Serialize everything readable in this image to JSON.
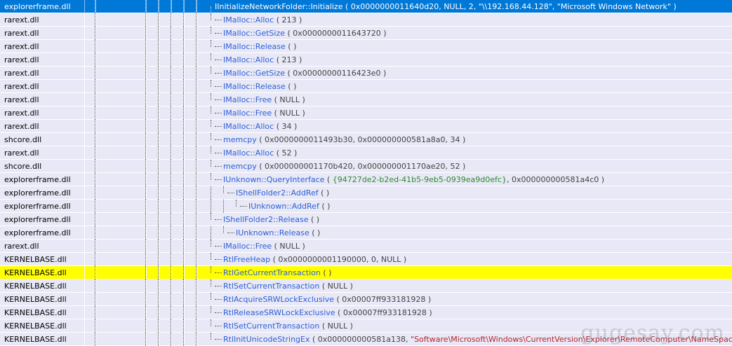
{
  "trace": {
    "rows": [
      {
        "module": "explorerframe.dll",
        "depth": 0,
        "state": "selected",
        "iface": "IInitializeNetworkFolder",
        "fn": "Initialize",
        "args": [
          {
            "t": "plain",
            "v": "( 0x0000000011640d20, NULL, 2, "
          },
          {
            "t": "str",
            "v": "\"\\\\192.168.44.128\""
          },
          {
            "t": "plain",
            "v": ", "
          },
          {
            "t": "str",
            "v": "\"Microsoft Windows Network\""
          },
          {
            "t": "plain",
            "v": " )"
          }
        ]
      },
      {
        "module": "rarext.dll",
        "depth": 1,
        "iface": "IMalloc",
        "fn": "Alloc",
        "args": [
          {
            "t": "plain",
            "v": "( 213 )"
          }
        ]
      },
      {
        "module": "rarext.dll",
        "depth": 1,
        "iface": "IMalloc",
        "fn": "GetSize",
        "args": [
          {
            "t": "plain",
            "v": "( 0x0000000011643720 )"
          }
        ]
      },
      {
        "module": "rarext.dll",
        "depth": 1,
        "iface": "IMalloc",
        "fn": "Release",
        "args": [
          {
            "t": "plain",
            "v": "(  )"
          }
        ]
      },
      {
        "module": "rarext.dll",
        "depth": 1,
        "iface": "IMalloc",
        "fn": "Alloc",
        "args": [
          {
            "t": "plain",
            "v": "( 213 )"
          }
        ]
      },
      {
        "module": "rarext.dll",
        "depth": 1,
        "iface": "IMalloc",
        "fn": "GetSize",
        "args": [
          {
            "t": "plain",
            "v": "( 0x00000000116423e0 )"
          }
        ]
      },
      {
        "module": "rarext.dll",
        "depth": 1,
        "iface": "IMalloc",
        "fn": "Release",
        "args": [
          {
            "t": "plain",
            "v": "(  )"
          }
        ]
      },
      {
        "module": "rarext.dll",
        "depth": 1,
        "iface": "IMalloc",
        "fn": "Free",
        "args": [
          {
            "t": "plain",
            "v": "( NULL )"
          }
        ]
      },
      {
        "module": "rarext.dll",
        "depth": 1,
        "iface": "IMalloc",
        "fn": "Free",
        "args": [
          {
            "t": "plain",
            "v": "( NULL )"
          }
        ]
      },
      {
        "module": "rarext.dll",
        "depth": 1,
        "iface": "IMalloc",
        "fn": "Alloc",
        "args": [
          {
            "t": "plain",
            "v": "( 34 )"
          }
        ]
      },
      {
        "module": "shcore.dll",
        "depth": 1,
        "iface": "",
        "fn": "memcpy",
        "args": [
          {
            "t": "plain",
            "v": "( 0x0000000011493b30, 0x000000000581a8a0, 34 )"
          }
        ]
      },
      {
        "module": "rarext.dll",
        "depth": 1,
        "iface": "IMalloc",
        "fn": "Alloc",
        "args": [
          {
            "t": "plain",
            "v": "( 52 )"
          }
        ]
      },
      {
        "module": "shcore.dll",
        "depth": 1,
        "iface": "",
        "fn": "memcpy",
        "args": [
          {
            "t": "plain",
            "v": "( 0x000000001170b420, 0x000000001170ae20, 52 )"
          }
        ]
      },
      {
        "module": "explorerframe.dll",
        "depth": 1,
        "iface": "IUnknown",
        "fn": "QueryInterface",
        "args": [
          {
            "t": "plain",
            "v": "( "
          },
          {
            "t": "guid",
            "v": "{94727de2-b2ed-41b5-9eb5-0939ea9d0efc}"
          },
          {
            "t": "plain",
            "v": ", 0x000000000581a4c0 )"
          }
        ]
      },
      {
        "module": "explorerframe.dll",
        "depth": 2,
        "iface": "IShellFolder2",
        "fn": "AddRef",
        "args": [
          {
            "t": "plain",
            "v": "(  )"
          }
        ]
      },
      {
        "module": "explorerframe.dll",
        "depth": 3,
        "iface": "IUnknown",
        "fn": "AddRef",
        "args": [
          {
            "t": "plain",
            "v": "(  )"
          }
        ]
      },
      {
        "module": "explorerframe.dll",
        "depth": 1,
        "iface": "IShellFolder2",
        "fn": "Release",
        "args": [
          {
            "t": "plain",
            "v": "(  )"
          }
        ]
      },
      {
        "module": "explorerframe.dll",
        "depth": 2,
        "iface": "IUnknown",
        "fn": "Release",
        "args": [
          {
            "t": "plain",
            "v": "(  )"
          }
        ]
      },
      {
        "module": "rarext.dll",
        "depth": 1,
        "iface": "IMalloc",
        "fn": "Free",
        "args": [
          {
            "t": "plain",
            "v": "( NULL )"
          }
        ]
      },
      {
        "module": "KERNELBASE.dll",
        "depth": 1,
        "iface": "",
        "fn": "RtlFreeHeap",
        "args": [
          {
            "t": "plain",
            "v": "( 0x0000000001190000, 0, NULL )"
          }
        ]
      },
      {
        "module": "KERNELBASE.dll",
        "depth": 1,
        "state": "highlighted",
        "iface": "",
        "fn": "RtlGetCurrentTransaction",
        "args": [
          {
            "t": "plain",
            "v": "(  )"
          }
        ]
      },
      {
        "module": "KERNELBASE.dll",
        "depth": 1,
        "iface": "",
        "fn": "RtlSetCurrentTransaction",
        "args": [
          {
            "t": "plain",
            "v": "( NULL )"
          }
        ]
      },
      {
        "module": "KERNELBASE.dll",
        "depth": 1,
        "iface": "",
        "fn": "RtlAcquireSRWLockExclusive",
        "args": [
          {
            "t": "plain",
            "v": "( 0x00007ff933181928 )"
          }
        ]
      },
      {
        "module": "KERNELBASE.dll",
        "depth": 1,
        "iface": "",
        "fn": "RtlReleaseSRWLockExclusive",
        "args": [
          {
            "t": "plain",
            "v": "( 0x00007ff933181928 )"
          }
        ]
      },
      {
        "module": "KERNELBASE.dll",
        "depth": 1,
        "iface": "",
        "fn": "RtlSetCurrentTransaction",
        "args": [
          {
            "t": "plain",
            "v": "( NULL )"
          }
        ]
      },
      {
        "module": "KERNELBASE.dll",
        "depth": 1,
        "iface": "",
        "fn": "RtlInitUnicodeStringEx",
        "args": [
          {
            "t": "plain",
            "v": "( 0x000000000581a138, "
          },
          {
            "t": "str",
            "v": "\"Software\\Microsoft\\Windows\\CurrentVersion\\Explorer\\RemoteComputer\\NameSpace\""
          },
          {
            "t": "plain",
            "v": " )"
          }
        ]
      }
    ]
  },
  "watermark": "gugesay.com",
  "colors": {
    "row_bg": "#e8e8f6",
    "selected_bg": "#0078d7",
    "highlight_bg": "#ffff00",
    "function_name": "#2b5fd6",
    "string_arg": "#b5262b"
  }
}
